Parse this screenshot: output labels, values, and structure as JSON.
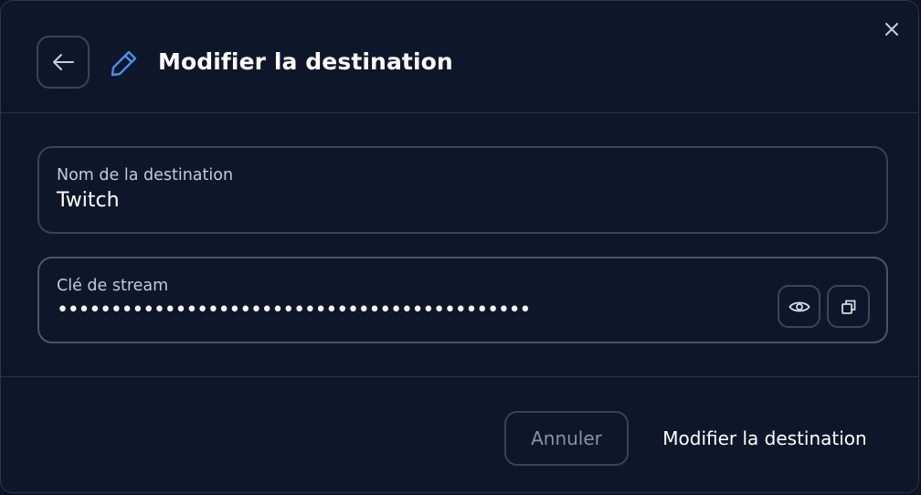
{
  "dialog": {
    "title": "Modifier la destination",
    "icons": {
      "close": "close-icon",
      "back": "arrow-left-icon",
      "edit": "pencil-icon",
      "reveal": "eye-icon",
      "copy": "copy-icon"
    },
    "colors": {
      "background": "#0e172a",
      "border": "#3a4356",
      "accent": "#4a8de8",
      "text": "#ffffff",
      "muted_text": "#c5cad4",
      "disabled_text": "#8a91a0"
    }
  },
  "form": {
    "name_field": {
      "label": "Nom de la destination",
      "value": "Twitch"
    },
    "stream_key_field": {
      "label": "Clé de stream",
      "masked_value": "••••••••••••••••••••••••••••••••••••••••••••"
    }
  },
  "footer": {
    "cancel_label": "Annuler",
    "submit_label": "Modifier la destination"
  }
}
